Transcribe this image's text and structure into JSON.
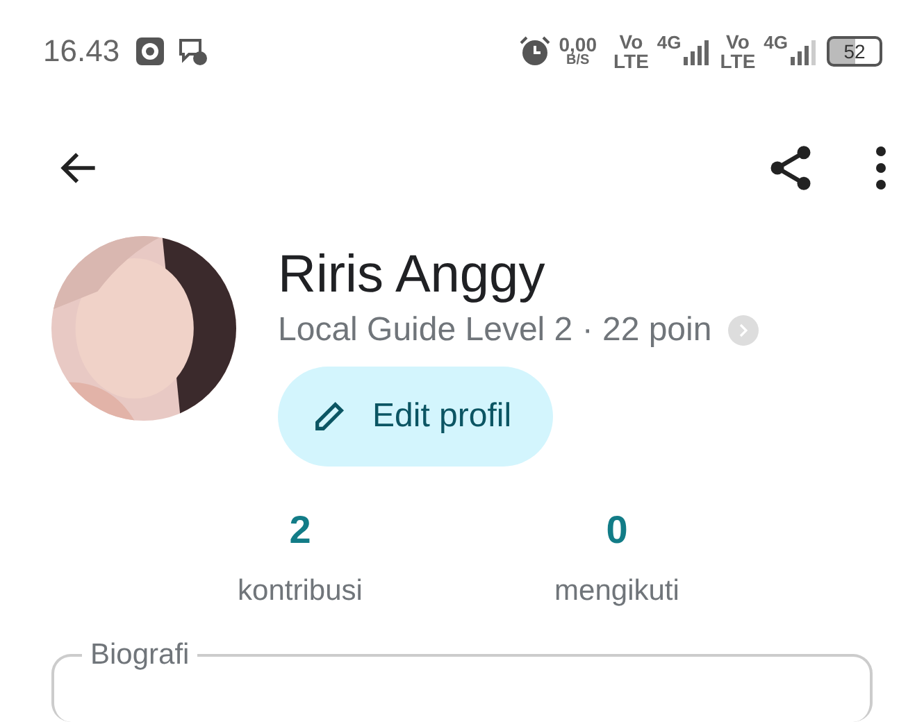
{
  "status_bar": {
    "time": "16.43",
    "speed": "0,00",
    "speed_unit": "B/S",
    "sim1": {
      "vo": "Vo",
      "lte": "LTE",
      "network": "4G"
    },
    "sim2": {
      "vo": "Vo",
      "lte": "LTE",
      "network": "4G"
    },
    "battery": "52"
  },
  "profile": {
    "name": "Riris Anggy",
    "subtitle": "Local Guide Level 2 · 22 poin",
    "edit_button": "Edit profil"
  },
  "stats": [
    {
      "value": "2",
      "label": "kontribusi"
    },
    {
      "value": "0",
      "label": "mengikuti"
    }
  ],
  "bio": {
    "label": "Biografi"
  }
}
